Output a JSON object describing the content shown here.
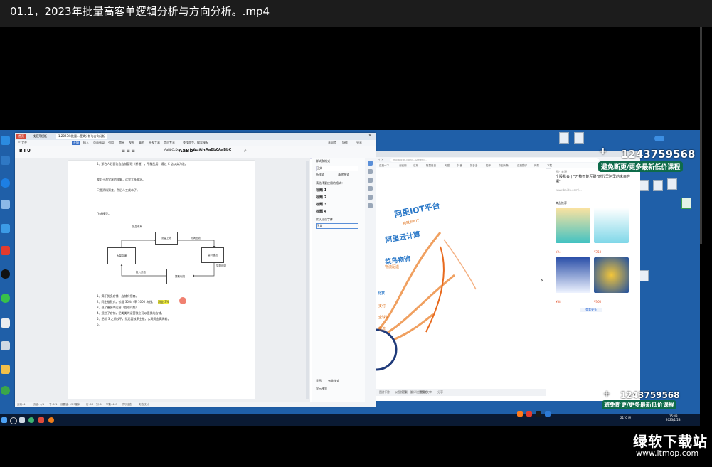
{
  "title": "01.1，2023年批量高客单逻辑分析与方向分析。.mp4",
  "wps": {
    "tabs": [
      "首页",
      "找稻壳模板",
      "1.2023年批量...逻辑分析与方向分析"
    ],
    "menu": [
      "三 文件",
      "开始",
      "插入",
      "页面布局",
      "引用",
      "审阅",
      "视图",
      "章节",
      "开发工具",
      "会员专享",
      "查找命令、搜索模板",
      "未同步",
      "协作",
      "分享"
    ],
    "styles": [
      "AaBbCcDd",
      "AaBb",
      "AaBb",
      "AaBbC",
      "AaBbC"
    ],
    "page": {
      "line1": "4、那台人后面包含店铺管理（新增），不能乱用，通过 C 店以卖为准。",
      "line2": "我对于淘宝客的理解，这里大多概念。",
      "line3": "只是资料筛查，然后人工成本了。",
      "dots": "·····················",
      "flow_title": "飞轮模型。",
      "node_top": "测量上线",
      "node_left": "大量店铺",
      "node_right": "高价值品",
      "node_bottom": "提取利润",
      "label_top": "批量布局",
      "label_right1": "利润回收",
      "label_right2": "复制利润",
      "label_bottom": "投入开店",
      "list": [
        "1、满于货多店铺，店铺有招商。",
        "2、同主推款式，长格 30%（率 1000 块钱。",
        "3、现了更多的运营（管理问题）",
        "4、规划了店铺，把类类的运营独立可以更换的店铺。",
        "5、把机 3 之间较不，然后要效率主推，实现资金高周转。",
        "6、"
      ],
      "highlight": "测金 3%"
    },
    "pane": {
      "title": "样式和格式",
      "current": "正文",
      "new_style": "新样式",
      "clear": "清除格式",
      "apply_label": "请选择要应用的格式：",
      "headings": [
        "标题 1",
        "标题 2",
        "标题 3",
        "标题 4"
      ],
      "default_font": "默认段落字体",
      "body": "正文",
      "show_label": "显示",
      "show_value": "有效样式",
      "preview": "显示预览"
    },
    "status": [
      "页码: 4",
      "页面: 4/4",
      "节: 1/1",
      "设置值: 13.3厘米",
      "行: 13",
      "列: 1",
      "字数: 403",
      "拼写检查",
      "文档校对"
    ]
  },
  "browser": {
    "url": "img.alicdn.com/...&refer=...",
    "bookmarks": [
      "百度一下",
      "淘宝网",
      "京东",
      "阿里巴巴",
      "天猫",
      "抖音",
      "拼多多",
      "知乎",
      "今日头条",
      "百度翻译",
      "网易",
      "下载"
    ],
    "mind": {
      "n1": "阿里IOT平台",
      "n1s": "物联网IOT",
      "n2": "阿里云计算",
      "n3": "菜鸟物流",
      "n3s": "物流配送",
      "n4": "北京",
      "n5": "支付",
      "n6": "全球化",
      "n7": "物流"
    },
    "viewer_bar": [
      "图片识别",
      "以图搜图",
      "翻译",
      "提取文字",
      "下载",
      "设置壁纸",
      "分享"
    ],
    "right": {
      "source": "图片来源",
      "headline": "个股机会 | “万物智能互联”时代里阿里的未来在哪？",
      "link": "www.baidu.com/...",
      "rec": "商品推荐",
      "p1": "¥24",
      "p2": "¥350",
      "p3": "¥38",
      "p4": "¥360",
      "more": "查看更多"
    }
  },
  "promo": {
    "phone": "1243759568",
    "text": "避免断更/更多最新低价课程",
    "plus": "+"
  },
  "taskbar": {
    "weather": "21°C 阴",
    "time": "15:43",
    "date": "2023/1/28"
  },
  "watermark": {
    "cn": "绿软下载站",
    "url": "www.itmop.com"
  }
}
